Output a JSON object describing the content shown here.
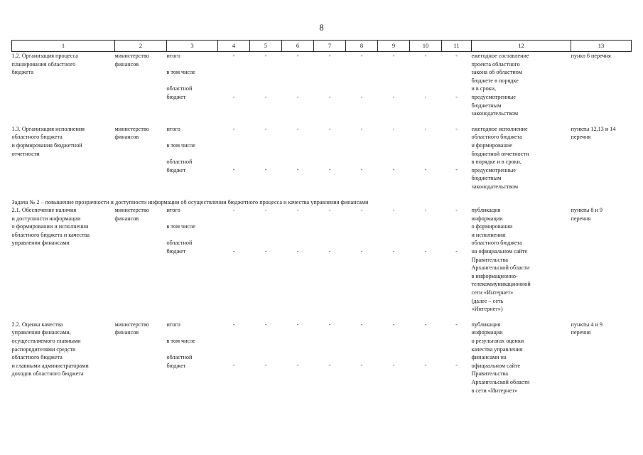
{
  "page": {
    "number": "8"
  },
  "table": {
    "headers": [
      "1",
      "2",
      "3",
      "4",
      "5",
      "6",
      "7",
      "8",
      "9",
      "10",
      "11",
      "12",
      "13"
    ],
    "empty_mark": "-",
    "rows": [
      {
        "kind": "data",
        "name": "1.2. Организация процесса\nпланирования областного\nбюджета",
        "executor": "министерство\nфинансов",
        "source": "итого\n\nв том числе\n\nобластной\nбюджет",
        "values_top": [
          "-",
          "-",
          "-",
          "-",
          "-",
          "-",
          "-",
          "-"
        ],
        "values_bottom": [
          "-",
          "-",
          "-",
          "-",
          "-",
          "-",
          "-",
          "-"
        ],
        "result": "ежегодное составление\nпроекта областного\nзакона об областном\nбюджете в порядке\nи в сроки,\nпредусмотренные\nбюджетным\nзаконодательством",
        "reference": "пункт 6 перечня"
      },
      {
        "kind": "data",
        "name": "1.3. Организация исполнения\nобластного бюджета\nи формирования бюджетной\nотчетности",
        "executor": "министерство\nфинансов",
        "source": "итого\n\nв том числе\n\nобластной\nбюджет",
        "values_top": [
          "-",
          "-",
          "-",
          "-",
          "-",
          "-",
          "-",
          "-"
        ],
        "values_bottom": [
          "-",
          "-",
          "-",
          "-",
          "-",
          "-",
          "-",
          "-"
        ],
        "result": "ежегодное исполнение\nобластного бюджета\nи формирование\nбюджетной отчетности\nв порядке и в сроки,\nпредусмотренные\nбюджетным\nзаконодательством",
        "reference": "пункты 12,13 и 14\nперечня"
      },
      {
        "kind": "task",
        "title": "Задача № 2 – повышение прозрачности и доступности информации об осуществлении бюджетного процесса и качества управления финансами"
      },
      {
        "kind": "data",
        "name": "2.1. Обеспечение наличия\nи доступности информации\nо формировании и исполнении\nобластного бюджета и качества\nуправления финансами",
        "executor": "министерство\nфинансов",
        "source": "итого\n\nв том числе\n\nобластной\nбюджет",
        "values_top": [
          "-",
          "-",
          "-",
          "-",
          "-",
          "-",
          "-",
          "-"
        ],
        "values_bottom": [
          "-",
          "-",
          "-",
          "-",
          "-",
          "-",
          "-",
          "-"
        ],
        "result": "публикация\nинформации\nо формировании\nи исполнении\nобластного бюджета\nна официальном сайте\nПравительства\nАрхангельской области\nв информационно-\nтелекоммуникационной\nсети «Интернет»\n(далее – сеть\n«Интернет»)",
        "reference": "пункты 8 и 9\nперечня"
      },
      {
        "kind": "data",
        "name": "2.2. Оценка качества\nуправления финансами,\nосуществляемого главными\nраспорядителями средств\nобластного бюджета\nи главными администраторами\nдоходов областного бюджета",
        "executor": "министерство\nфинансов",
        "source": "итого\n\nв том числе\n\nобластной\nбюджет",
        "values_top": [
          "-",
          "-",
          "-",
          "-",
          "-",
          "-",
          "-",
          "-"
        ],
        "values_bottom": [
          "-",
          "-",
          "-",
          "-",
          "-",
          "-",
          "-",
          "-"
        ],
        "result": "публикация\nинформации\nо результатах оценки\nкачества управления\nфинансами на\nофициальном сайте\nПравительства\nАрхангельской области\nв сети «Интернет»",
        "reference": "пункты 4 и 9\nперечня"
      }
    ]
  }
}
